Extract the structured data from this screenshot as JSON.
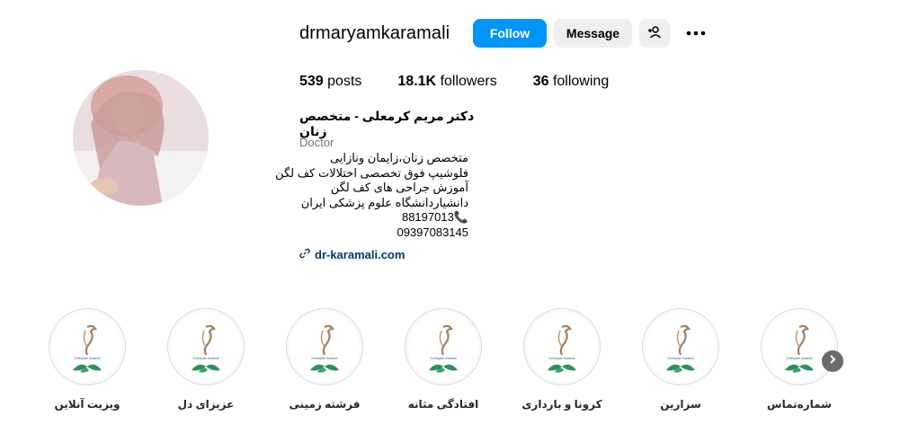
{
  "profile": {
    "username": "drmaryamkaramali",
    "full_name": "دکتر مریم کرمعلی - متخصص زنان",
    "category": "Doctor",
    "bio_lines": [
      "متخصص زنان،زایمان ونازایی",
      "فلوشیپ فوق تخصصی اختلالات کف لگن",
      "آموزش جراحی های کف لگن",
      "دانشیاردانشگاه علوم پزشکی ایران",
      "88197013📞",
      "09397083145"
    ],
    "link": "dr-karamali.com"
  },
  "actions": {
    "follow": "Follow",
    "message": "Message"
  },
  "stats": {
    "posts_count": "539",
    "posts_label": "posts",
    "followers_count": "18.1K",
    "followers_label": "followers",
    "following_count": "36",
    "following_label": "following"
  },
  "highlights": [
    {
      "label": "شماره‌تماس"
    },
    {
      "label": "سزارین"
    },
    {
      "label": "کرونا و بارداری"
    },
    {
      "label": "افتادگی مثانه"
    },
    {
      "label": "فرشته زمینی"
    },
    {
      "label": "عزیزای دل"
    },
    {
      "label": "ویزیت آنلاین"
    }
  ],
  "colors": {
    "follow_bg": "#0095f6",
    "secondary_btn_bg": "#efefef",
    "link": "#00376b",
    "muted": "#737373"
  }
}
